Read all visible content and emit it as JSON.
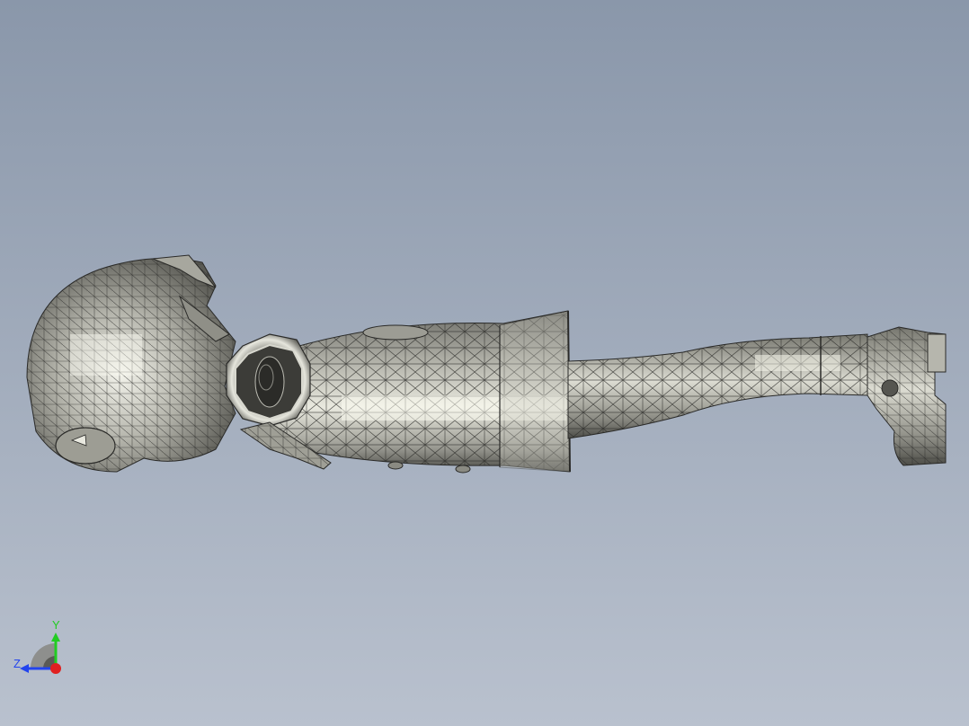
{
  "viewport": {
    "background_top": "#8a97aa",
    "background_bottom": "#b9c1ce"
  },
  "model": {
    "shade_light": "#efefe8",
    "shade_mid": "#a8a89f",
    "shade_dark": "#55554f",
    "edge_color": "#2a2a28",
    "highlight": "#fbfbf3"
  },
  "triad": {
    "x_color": "#e02020",
    "y_color": "#22cc22",
    "z_color": "#2244ee",
    "y_label": "Y",
    "z_label": "Z"
  }
}
